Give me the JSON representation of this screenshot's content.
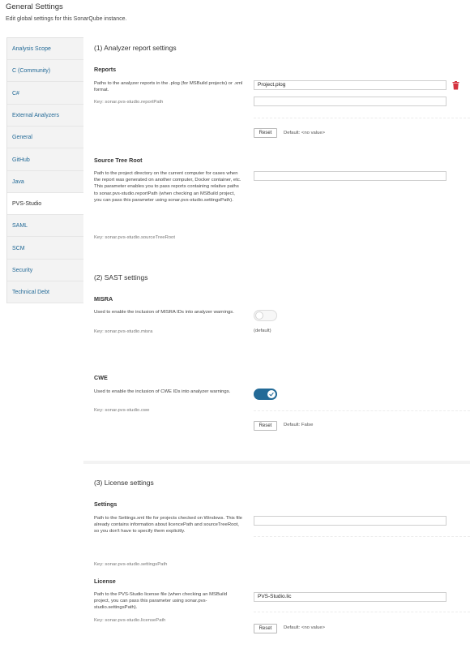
{
  "header": {
    "title": "General Settings",
    "subtitle": "Edit global settings for this SonarQube instance."
  },
  "sidebar": {
    "items": [
      {
        "label": "Analysis Scope",
        "active": false
      },
      {
        "label": "C (Community)",
        "active": false
      },
      {
        "label": "C#",
        "active": false
      },
      {
        "label": "External Analyzers",
        "active": false
      },
      {
        "label": "General",
        "active": false
      },
      {
        "label": "GitHub",
        "active": false
      },
      {
        "label": "Java",
        "active": false
      },
      {
        "label": "PVS-Studio",
        "active": true
      },
      {
        "label": "SAML",
        "active": false
      },
      {
        "label": "SCM",
        "active": false
      },
      {
        "label": "Security",
        "active": false
      },
      {
        "label": "Technical Debt",
        "active": false
      }
    ]
  },
  "sections": {
    "analyzer": {
      "title": "(1) Analyzer report settings",
      "reports": {
        "title": "Reports",
        "description": "Paths to the analyzer reports in the .plog (for MSBuild projects) or .xml format.",
        "key": "Key: sonar.pvs-studio.reportPath",
        "values": [
          "Project.plog",
          ""
        ],
        "reset_label": "Reset",
        "default_text": "Default: <no value>",
        "delete_icon": "trash-icon",
        "delete_color": "#d4333f"
      },
      "source_root": {
        "title": "Source Tree Root",
        "description": "Path to the project directory on the current computer for cases when the report was generated on another computer, Docker container, etc. This parameter enables you to pass reports containing relative paths to sonar.pvs-studio.reportPath (when checking an MSBuild project, you can pass this parameter using sonar.pvs-studio.settingsPath).",
        "key": "Key: sonar.pvs-studio.sourceTreeRoot",
        "value": ""
      }
    },
    "sast": {
      "title": "(2) SAST settings",
      "misra": {
        "title": "MISRA",
        "description": "Used to enable the inclusion of MISRA IDs into analyzer warnings.",
        "key": "Key: sonar.pvs-studio.misra",
        "enabled": false,
        "default_text": "(default)"
      },
      "cwe": {
        "title": "CWE",
        "description": "Used to enable the inclusion of CWE IDs into analyzer warnings.",
        "key": "Key: sonar.pvs-studio.cwe",
        "enabled": true,
        "reset_label": "Reset",
        "default_text": "Default: False"
      }
    },
    "license": {
      "title": "(3) License settings",
      "settings": {
        "title": "Settings",
        "description": "Path to the Settings.xml file for projects checked on Windows. This file already contains information about licencePath and sourceTreeRoot, so you don't have to specify them explicitly.",
        "key": "Key: sonar.pvs-studio.settingsPath",
        "value": ""
      },
      "license": {
        "title": "License",
        "description": "Path to the PVS-Studio license file (when checking an MSBuild project, you can pass this parameter using sonar.pvs-studio.settingsPath).",
        "key": "Key: sonar.pvs-studio.licensePath",
        "value": "PVS-Studio.lic",
        "reset_label": "Reset",
        "default_text": "Default: <no value>"
      }
    }
  },
  "colors": {
    "accent": "#236a97",
    "link": "#236a97",
    "danger": "#d4333f"
  }
}
